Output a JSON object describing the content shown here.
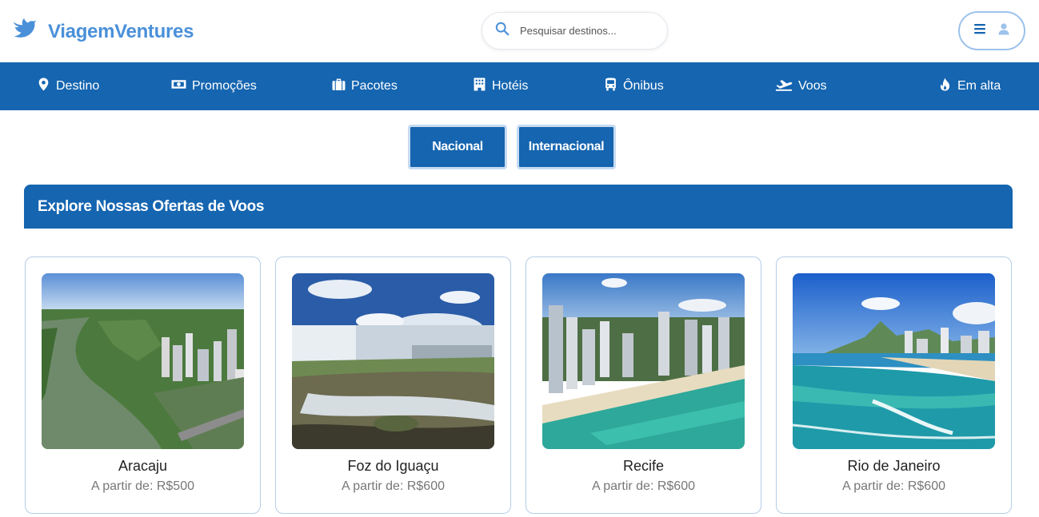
{
  "brand": {
    "name": "ViagemVentures",
    "color": "#4a90d9"
  },
  "search": {
    "placeholder": "Pesquisar destinos..."
  },
  "nav": {
    "background": "#1565b0",
    "items": [
      {
        "label": "Destino",
        "icon": "map-pin-icon"
      },
      {
        "label": "Promoções",
        "icon": "money-bill-icon"
      },
      {
        "label": "Pacotes",
        "icon": "suitcase-icon"
      },
      {
        "label": "Hotéis",
        "icon": "hotel-icon"
      },
      {
        "label": "Ônibus",
        "icon": "bus-icon"
      },
      {
        "label": "Voos",
        "icon": "plane-departure-icon"
      },
      {
        "label": "Em alta",
        "icon": "fire-icon"
      }
    ]
  },
  "tabs": [
    {
      "label": "Nacional"
    },
    {
      "label": "Internacional"
    }
  ],
  "section": {
    "title": "Explore Nossas Ofertas de Voos"
  },
  "cards": [
    {
      "title": "Aracaju",
      "price": "A partir de: R$500"
    },
    {
      "title": "Foz do Iguaçu",
      "price": "A partir de: R$600"
    },
    {
      "title": "Recife",
      "price": "A partir de: R$600"
    },
    {
      "title": "Rio de Janeiro",
      "price": "A partir de: R$600"
    }
  ]
}
